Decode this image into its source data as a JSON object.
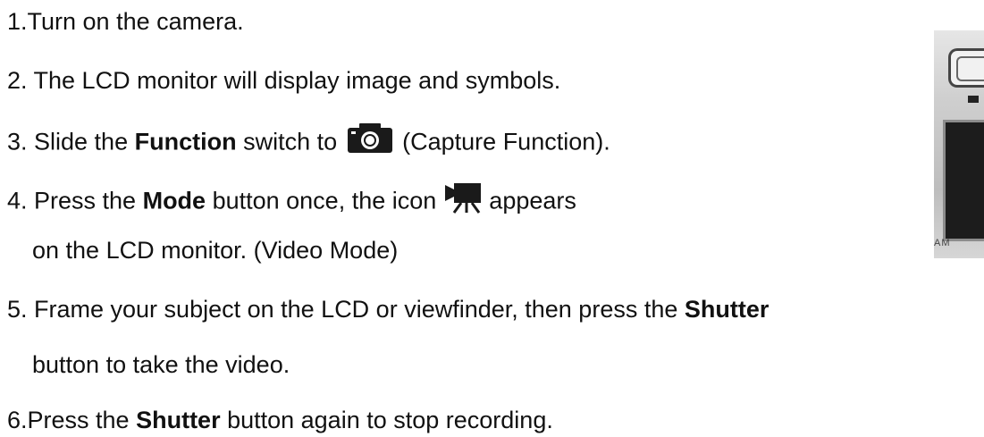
{
  "steps": [
    {
      "prefix": "1.Turn on the camera."
    },
    {
      "prefix": "2. The LCD monitor will display image and symbols."
    },
    {
      "prefix": "3. Slide the ",
      "bold": "Function",
      "mid": " switch to ",
      "icon": "camera-capture-icon",
      "suffix": " (Capture Function)."
    },
    {
      "prefix": "4. Press the ",
      "bold": "Mode",
      "mid": " button once, the icon ",
      "icon": "video-camera-icon",
      "suffix": " appears"
    },
    {
      "prefix": "on the LCD monitor. (Video Mode)"
    },
    {
      "prefix": "5. Frame your subject on the LCD or viewfinder, then press the ",
      "bold": "Shutter"
    },
    {
      "prefix": "button to take the video."
    },
    {
      "prefix": "6.Press the ",
      "bold": "Shutter",
      "suffix": " button again to stop recording."
    }
  ],
  "camera_photo": {
    "label": "AM"
  },
  "colors": {
    "text": "#111111",
    "background": "#ffffff"
  }
}
